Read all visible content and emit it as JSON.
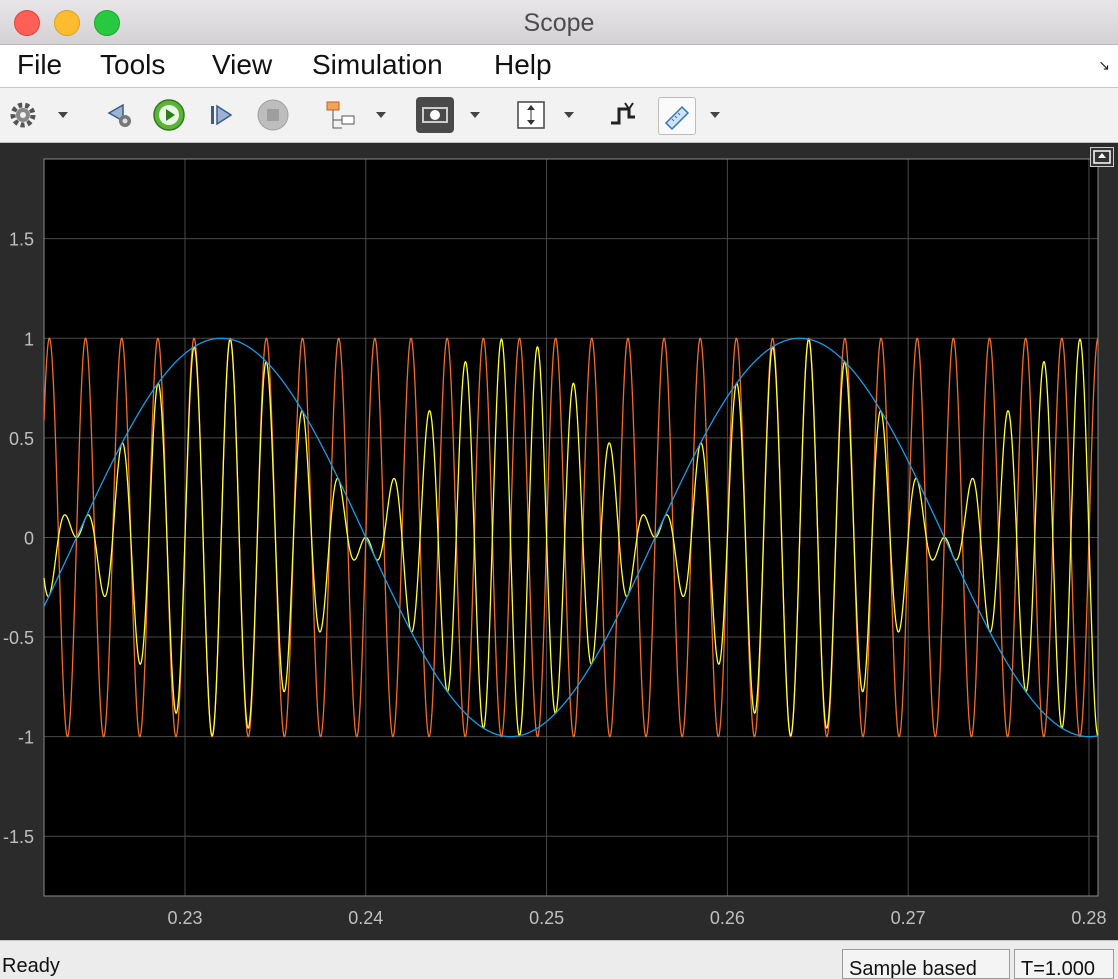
{
  "window": {
    "title": "Scope"
  },
  "menu": {
    "items": [
      "File",
      "Tools",
      "View",
      "Simulation",
      "Help"
    ]
  },
  "toolbar": {
    "icons": [
      "gear-icon",
      "step-back-icon",
      "run-icon",
      "step-forward-icon",
      "stop-icon",
      "signal-selector-icon",
      "highlight-icon",
      "autoscale-icon",
      "triggers-icon",
      "measurements-icon"
    ]
  },
  "status": {
    "state": "Ready",
    "mode": "Sample based",
    "time": "T=1.000"
  },
  "colors": {
    "background": "#000000",
    "grid": "#4a4a4a",
    "tick_label": "#bfbfbf"
  },
  "chart_data": {
    "type": "line",
    "title": "",
    "xlabel": "",
    "ylabel": "",
    "xlim": [
      0.2222,
      0.2805
    ],
    "ylim": [
      -1.8,
      1.9
    ],
    "xticks": [
      0.23,
      0.24,
      0.25,
      0.26,
      0.27,
      0.28
    ],
    "xtick_labels": [
      "0.23",
      "0.24",
      "0.25",
      "0.26",
      "0.27",
      "0.28"
    ],
    "yticks": [
      -1.5,
      -1,
      -0.5,
      0,
      0.5,
      1,
      1.5
    ],
    "ytick_labels": [
      "-1.5",
      "-1",
      "-0.5",
      "0",
      "0.5",
      "1",
      "1.5"
    ],
    "grid": true,
    "legend": "none",
    "series": [
      {
        "color": "#f26b2a",
        "function": "sin",
        "frequency_hz": 500,
        "amplitude": 1,
        "phase": 0
      },
      {
        "color": "#ffff3a",
        "function": "product",
        "frequency_hz": 500,
        "amplitude": 1,
        "phase": 0
      },
      {
        "color": "#1a9be6",
        "function": "sin",
        "frequency_hz": 31.25,
        "amplitude": 1,
        "phase": 0
      }
    ]
  }
}
